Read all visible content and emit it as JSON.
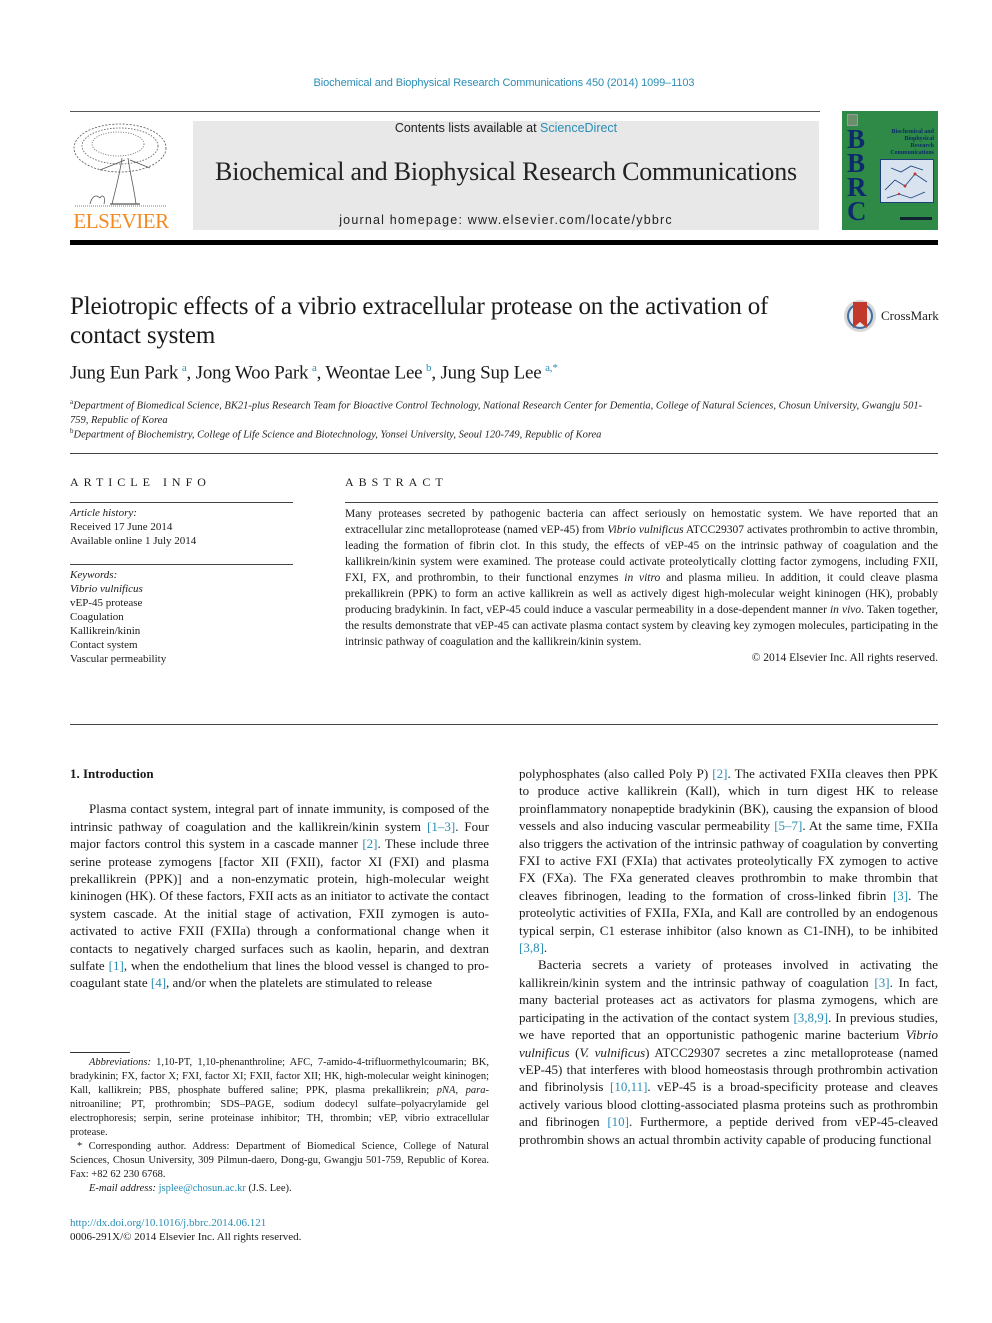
{
  "running_header": "Biochemical and Biophysical Research Communications 450 (2014) 1099–1103",
  "masthead": {
    "publisher": "ELSEVIER",
    "contents_prefix": "Contents lists available at ",
    "contents_link": "ScienceDirect",
    "journal_title": "Biochemical and Biophysical Research Communications",
    "homepage": "journal homepage: www.elsevier.com/locate/ybbrc",
    "cover": {
      "letters": [
        "B",
        "B",
        "R",
        "C"
      ],
      "title_lines": [
        "Biochemical and",
        "Biophysical",
        "Research",
        "Communications"
      ],
      "color": "#2e8a46"
    }
  },
  "article": {
    "title": "Pleiotropic effects of a vibrio extracellular protease on the activation of contact system",
    "crossmark_label": "CrossMark",
    "authors": [
      {
        "name": "Jung Eun Park",
        "aff": "a"
      },
      {
        "name": "Jong Woo Park",
        "aff": "a"
      },
      {
        "name": "Weontae Lee",
        "aff": "b"
      },
      {
        "name": "Jung Sup Lee",
        "aff": "a,*"
      }
    ],
    "affiliations": [
      {
        "label": "a",
        "text": "Department of Biomedical Science, BK21-plus Research Team for Bioactive Control Technology, National Research Center for Dementia, College of Natural Sciences, Chosun University, Gwangju 501-759, Republic of Korea"
      },
      {
        "label": "b",
        "text": "Department of Biochemistry, College of Life Science and Biotechnology, Yonsei University, Seoul 120-749, Republic of Korea"
      }
    ]
  },
  "article_info": {
    "heading": "ARTICLE INFO",
    "history_label": "Article history:",
    "received": "Received 17 June 2014",
    "online": "Available online 1 July 2014",
    "keywords_label": "Keywords:",
    "keywords": [
      "Vibrio vulnificus",
      "vEP-45 protease",
      "Coagulation",
      "Kallikrein/kinin",
      "Contact system",
      "Vascular permeability"
    ]
  },
  "abstract": {
    "heading": "ABSTRACT",
    "parts": [
      "Many proteases secreted by pathogenic bacteria can affect seriously on hemostatic system. We have reported that an extracellular zinc metalloprotease (named vEP-45) from ",
      "Vibrio vulnificus",
      " ATCC29307 activates prothrombin to active thrombin, leading the formation of fibrin clot. In this study, the effects of vEP-45 on the intrinsic pathway of coagulation and the kallikrein/kinin system were examined. The protease could activate proteolytically clotting factor zymogens, including FXII, FXI, FX, and prothrombin, to their functional enzymes ",
      "in vitro",
      " and plasma milieu. In addition, it could cleave plasma prekallikrein (PPK) to form an active kallikrein as well as actively digest high-molecular weight kininogen (HK), probably producing bradykinin. In fact, vEP-45 could induce a vascular permeability in a dose-dependent manner ",
      "in vivo",
      ". Taken together, the results demonstrate that vEP-45 can activate plasma contact system by cleaving key zymogen molecules, participating in the intrinsic pathway of coagulation and the kallikrein/kinin system."
    ],
    "copyright": "© 2014 Elsevier Inc. All rights reserved."
  },
  "introduction": {
    "heading": "1. Introduction",
    "left_column": [
      "Plasma contact system, integral part of innate immunity, is composed of the intrinsic pathway of coagulation and the kallikrein/kinin system ",
      "[1–3]",
      ". Four major factors control this system in a cascade manner ",
      "[2]",
      ". These include three serine protease zymogens [factor XII (FXII), factor XI (FXI) and plasma prekallikrein (PPK)] and a non-enzymatic protein, high-molecular weight kininogen (HK). Of these factors, FXII acts as an initiator to activate the contact system cascade. At the initial stage of activation, FXII zymogen is auto-activated to active FXII (FXIIa) through a conformational change when it contacts to negatively charged surfaces such as kaolin, heparin, and dextran sulfate ",
      "[1]",
      ", when the endothelium that lines the blood vessel is changed to pro-coagulant state ",
      "[4]",
      ", and/or when the platelets are stimulated to release"
    ],
    "right_column_p1": [
      "polyphosphates (also called Poly P) ",
      "[2]",
      ". The activated FXIIa cleaves then PPK to produce active kallikrein (Kall), which in turn digest HK to release proinflammatory nonapeptide bradykinin (BK), causing the expansion of blood vessels and also inducing vascular permeability ",
      "[5–7]",
      ". At the same time, FXIIa also triggers the activation of the intrinsic pathway of coagulation by converting FXI to active FXI (FXIa) that activates proteolytically FX zymogen to active FX (FXa). The FXa generated cleaves prothrombin to make thrombin that cleaves fibrinogen, leading to the formation of cross-linked fibrin ",
      "[3]",
      ". The proteolytic activities of FXIIa, FXIa, and Kall are controlled by an endogenous typical serpin, C1 esterase inhibitor (also known as C1-INH), to be inhibited ",
      "[3,8]",
      "."
    ],
    "right_column_p2": [
      "Bacteria secrets a variety of proteases involved in activating the kallikrein/kinin system and the intrinsic pathway of coagulation ",
      "[3]",
      ". In fact, many bacterial proteases act as activators for plasma zymogens, which are participating in the activation of the contact system ",
      "[3,8,9]",
      ". In previous studies, we have reported that an opportunistic pathogenic marine bacterium ",
      "Vibrio vulnificus",
      " (",
      "V. vulnificus",
      ") ATCC29307 secretes a zinc metalloprotease (named vEP-45) that interferes with blood homeostasis through prothrombin activation and fibrinolysis ",
      "[10,11]",
      ". vEP-45 is a broad-specificity protease and cleaves actively various blood clotting-associated plasma proteins such as prothrombin and fibrinogen ",
      "[10]",
      ". Furthermore, a peptide derived from vEP-45-cleaved prothrombin shows an actual thrombin activity capable of producing functional"
    ]
  },
  "footnotes": {
    "abbrev_label": "Abbreviations:",
    "abbrev_text_1": " 1,10-PT, 1,10-phenanthroline; AFC, 7-amido-4-trifluormethylcoumarin; BK, bradykinin; FX, factor X; FXI, factor XI; FXII, factor XII; HK, high-molecular weight kininogen; Kall, kallikrein; PBS, phosphate buffered saline; PPK, plasma prekallikrein; ",
    "abbrev_pna": "pNA",
    "abbrev_text_2": ", ",
    "abbrev_para": "para",
    "abbrev_text_3": "-nitroaniline; PT, prothrombin; SDS–PAGE, sodium dodecyl sulfate–polyacrylamide gel electrophoresis; serpin, serine proteinase inhibitor; TH, thrombin; vEP, vibrio extracellular protease.",
    "corresponding": "* Corresponding author. Address: Department of Biomedical Science, College of Natural Sciences, Chosun University, 309 Pilmun-daero, Dong-gu, Gwangju 501-759, Republic of Korea. Fax: +82 62 230 6768.",
    "email_label": "E-mail address:",
    "email": "jsplee@chosun.ac.kr",
    "email_suffix": " (J.S. Lee)."
  },
  "doi": {
    "link": "http://dx.doi.org/10.1016/j.bbrc.2014.06.121",
    "issn": "0006-291X/© 2014 Elsevier Inc. All rights reserved."
  },
  "colors": {
    "link": "#2a8db5",
    "elsevier_orange": "#f28b22",
    "masthead_grey": "#e8e8e8",
    "crossmark_red": "#c0392b",
    "crossmark_blue": "#3d6fa5"
  }
}
